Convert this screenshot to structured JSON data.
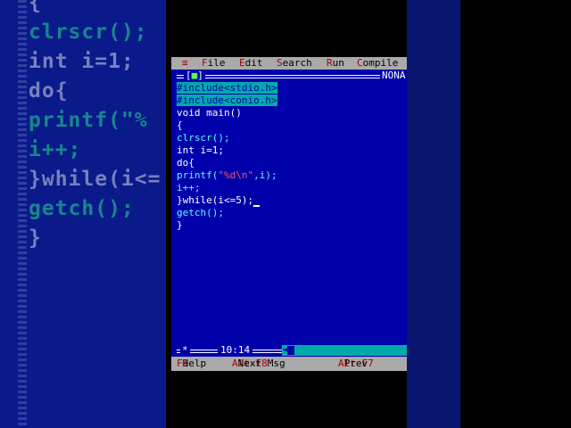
{
  "background_text": {
    "lines": [
      {
        "text": "{",
        "cls": "bg-white"
      },
      {
        "text": "clrscr();",
        "cls": ""
      },
      {
        "text": "int i=1;",
        "cls": "bg-white"
      },
      {
        "text": "do{",
        "cls": "bg-white"
      },
      {
        "text": "printf(\"%",
        "cls": ""
      },
      {
        "text": "i++;",
        "cls": ""
      },
      {
        "text": "}while(i<=",
        "cls": "bg-white"
      },
      {
        "text": "getch();",
        "cls": ""
      },
      {
        "text": "}",
        "cls": "bg-white"
      }
    ]
  },
  "menubar": {
    "system": "≡",
    "items": [
      {
        "hot": "F",
        "rest": "ile"
      },
      {
        "hot": "E",
        "rest": "dit"
      },
      {
        "hot": "S",
        "rest": "earch"
      },
      {
        "hot": "R",
        "rest": "un"
      },
      {
        "hot": "C",
        "rest": "ompile"
      }
    ]
  },
  "window": {
    "close_box": "[",
    "close_mark": "■",
    "close_box_end": "]",
    "filename": "NONA"
  },
  "editor": {
    "lines": [
      "#include<stdio.h>",
      "#include<conio.h>",
      "void main()",
      "{",
      "clrscr();",
      "int i=1;",
      "do{",
      "printf(\"%d\\n\",i);",
      "i++;",
      "}while(i<=5);",
      "getch();",
      "}"
    ]
  },
  "status": {
    "modified": "*",
    "position": "10:14",
    "scroll_arrow": "◄"
  },
  "helpbar": {
    "items": [
      {
        "key": "F1",
        "label": "Help"
      },
      {
        "key": "Alt-F8",
        "label": "Next Msg"
      },
      {
        "key": "Alt-F7",
        "label": "Prev"
      }
    ]
  }
}
